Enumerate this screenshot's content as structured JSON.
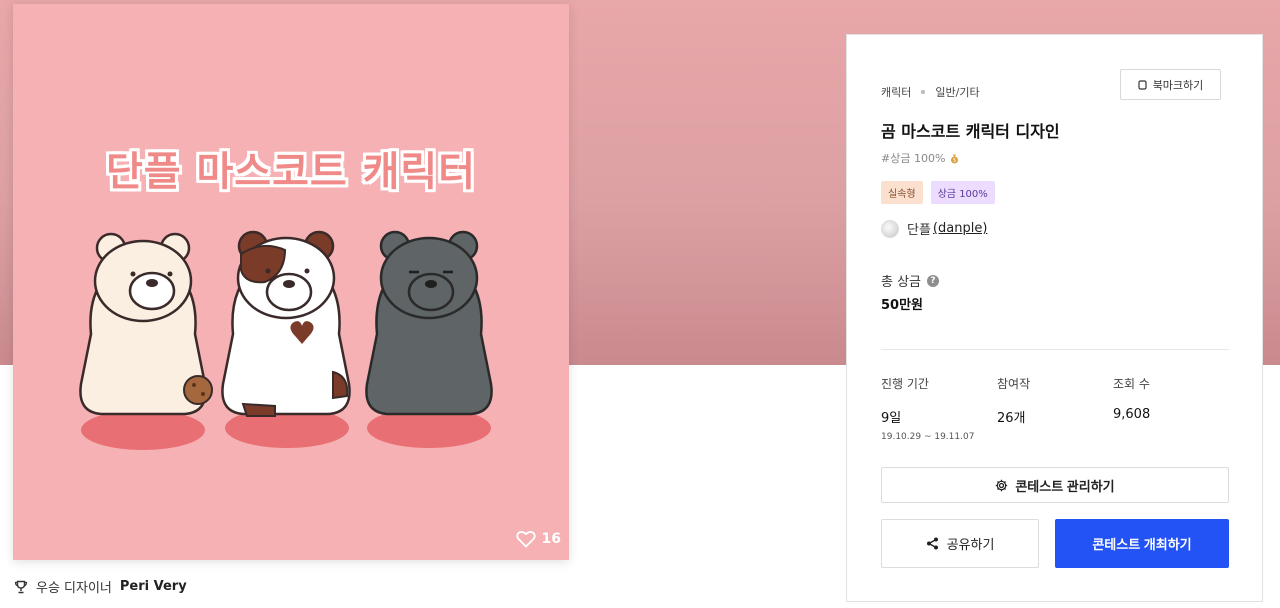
{
  "hero": {
    "title": "단플 마스코트 캐릭터",
    "like_count": "16"
  },
  "winner": {
    "label": "우승 디자이너",
    "name": "Peri Very"
  },
  "panel": {
    "category": "캐릭터",
    "subcategory": "일반/기타",
    "bookmark_label": "북마크하기",
    "title": "곰 마스코트 캐릭터 디자인",
    "hashtag": "#상금 100%",
    "tags": [
      "실속형",
      "상금 100%"
    ],
    "host_name": "단플",
    "host_handle": "(danple)",
    "prize_label": "총 상금",
    "prize_value": "50만원",
    "stats": {
      "period_label": "진행 기간",
      "period_value": "9일",
      "period_range": "19.10.29 ~ 19.11.07",
      "entries_label": "참여작",
      "entries_value": "26개",
      "views_label": "조회 수",
      "views_value": "9,608"
    },
    "manage_label": "콘테스트 관리하기",
    "share_label": "공유하기",
    "open_label": "콘테스트 개최하기"
  },
  "colors": {
    "band": "#e8a7a9",
    "hero_bg": "#f5b1b3",
    "accent_blue": "#2353f5"
  },
  "icons": {
    "like": "heart-icon",
    "winner": "trophy-icon",
    "bookmark": "bookmark-icon",
    "help": "question-icon",
    "manage": "gear-icon",
    "share": "share-icon"
  }
}
